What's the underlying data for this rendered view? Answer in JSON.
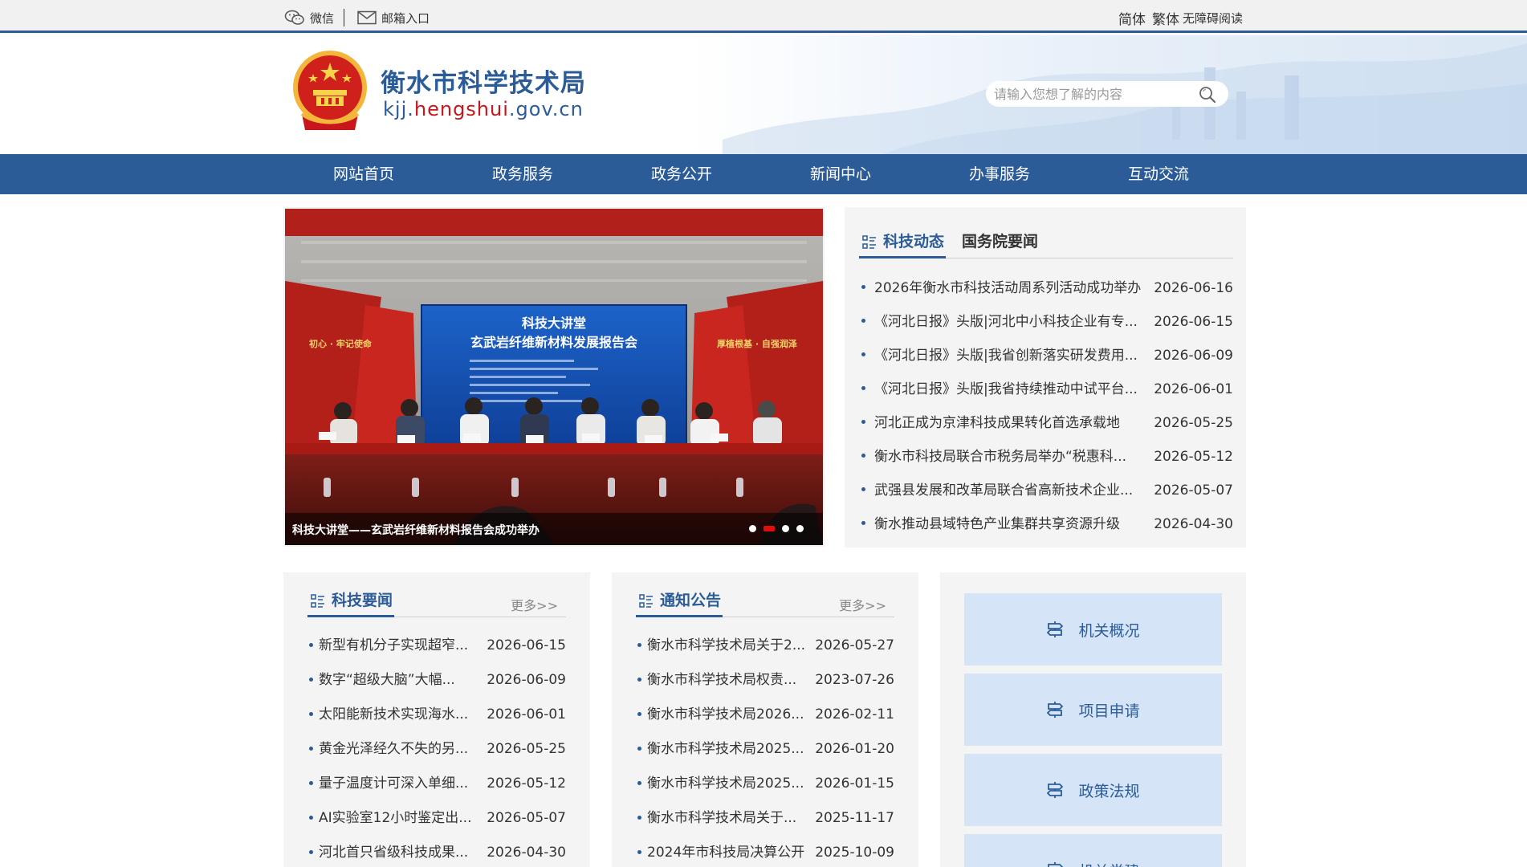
{
  "topbar": {
    "wechat": "微信",
    "mail": "邮箱入口",
    "simplified": "简体",
    "traditional": "繁体",
    "accessible": "无障碍阅读"
  },
  "header": {
    "title": "衡水市科学技术局",
    "domain_prefix": "kjj.",
    "domain_mid": "hengshui",
    "domain_suffix": ".gov.cn",
    "search_placeholder": "请输入您想了解的内容"
  },
  "nav": [
    {
      "label": "网站首页"
    },
    {
      "label": "政务服务"
    },
    {
      "label": "政务公开"
    },
    {
      "label": "新闻中心"
    },
    {
      "label": "办事服务"
    },
    {
      "label": "互动交流"
    }
  ],
  "banner": {
    "caption": "科技大讲堂——玄武岩纤维新材料报告会成功举办",
    "screen_line1": "科技大讲堂",
    "screen_line2": "玄武岩纤维新材料发展报告会",
    "wall_left": "初心 · 牢记使命",
    "wall_right": "厚植根基 · 自强润泽",
    "slide_count": 4,
    "active_slide": 2
  },
  "news_panel": {
    "tab_active": "科技动态",
    "tab_inactive": "国务院要闻",
    "items": [
      {
        "title": "2026年衡水市科技活动周系列活动成功举办",
        "date": "2026-06-16"
      },
      {
        "title": "《河北日报》头版|河北中小科技企业有专...",
        "date": "2026-06-15"
      },
      {
        "title": "《河北日报》头版|我省创新落实研发费用...",
        "date": "2026-06-09"
      },
      {
        "title": "《河北日报》头版|我省持续推动中试平台...",
        "date": "2026-06-01"
      },
      {
        "title": "河北正成为京津科技成果转化首选承载地",
        "date": "2026-05-25"
      },
      {
        "title": "衡水市科技局联合市税务局举办“税惠科...",
        "date": "2026-05-12"
      },
      {
        "title": "武强县发展和改革局联合省高新技术企业...",
        "date": "2026-05-07"
      },
      {
        "title": "衡水推动县域特色产业集群共享资源升级",
        "date": "2026-04-30"
      }
    ]
  },
  "tech_news": {
    "title": "科技要闻",
    "more": "更多>>",
    "items": [
      {
        "title": "新型有机分子实现超窄...",
        "date": "2026-06-15"
      },
      {
        "title": "数字“超级大脑”大幅...",
        "date": "2026-06-09"
      },
      {
        "title": "太阳能新技术实现海水...",
        "date": "2026-06-01"
      },
      {
        "title": "黄金光泽经久不失的另...",
        "date": "2026-05-25"
      },
      {
        "title": "量子温度计可深入单细...",
        "date": "2026-05-12"
      },
      {
        "title": "AI实验室12小时鉴定出...",
        "date": "2026-05-07"
      },
      {
        "title": "河北首只省级科技成果...",
        "date": "2026-04-30"
      }
    ]
  },
  "notices": {
    "title": "通知公告",
    "more": "更多>>",
    "items": [
      {
        "title": "衡水市科学技术局关于2...",
        "date": "2026-05-27"
      },
      {
        "title": "衡水市科学技术局权责...",
        "date": "2023-07-26"
      },
      {
        "title": "衡水市科学技术局2026...",
        "date": "2026-02-11"
      },
      {
        "title": "衡水市科学技术局2025...",
        "date": "2026-01-20"
      },
      {
        "title": "衡水市科学技术局2025...",
        "date": "2026-01-15"
      },
      {
        "title": "衡水市科学技术局关于...",
        "date": "2025-11-17"
      },
      {
        "title": "2024年市科技局决算公开",
        "date": "2025-10-09"
      }
    ]
  },
  "quick_links": [
    {
      "label": "机关概况"
    },
    {
      "label": "项目申请"
    },
    {
      "label": "政策法规"
    },
    {
      "label": "机关党建"
    }
  ],
  "colors": {
    "primary": "#2b5c98",
    "accent_red": "#c8161d",
    "quick_bg": "#d5e4f6",
    "panel_bg": "#f4f4f4"
  }
}
